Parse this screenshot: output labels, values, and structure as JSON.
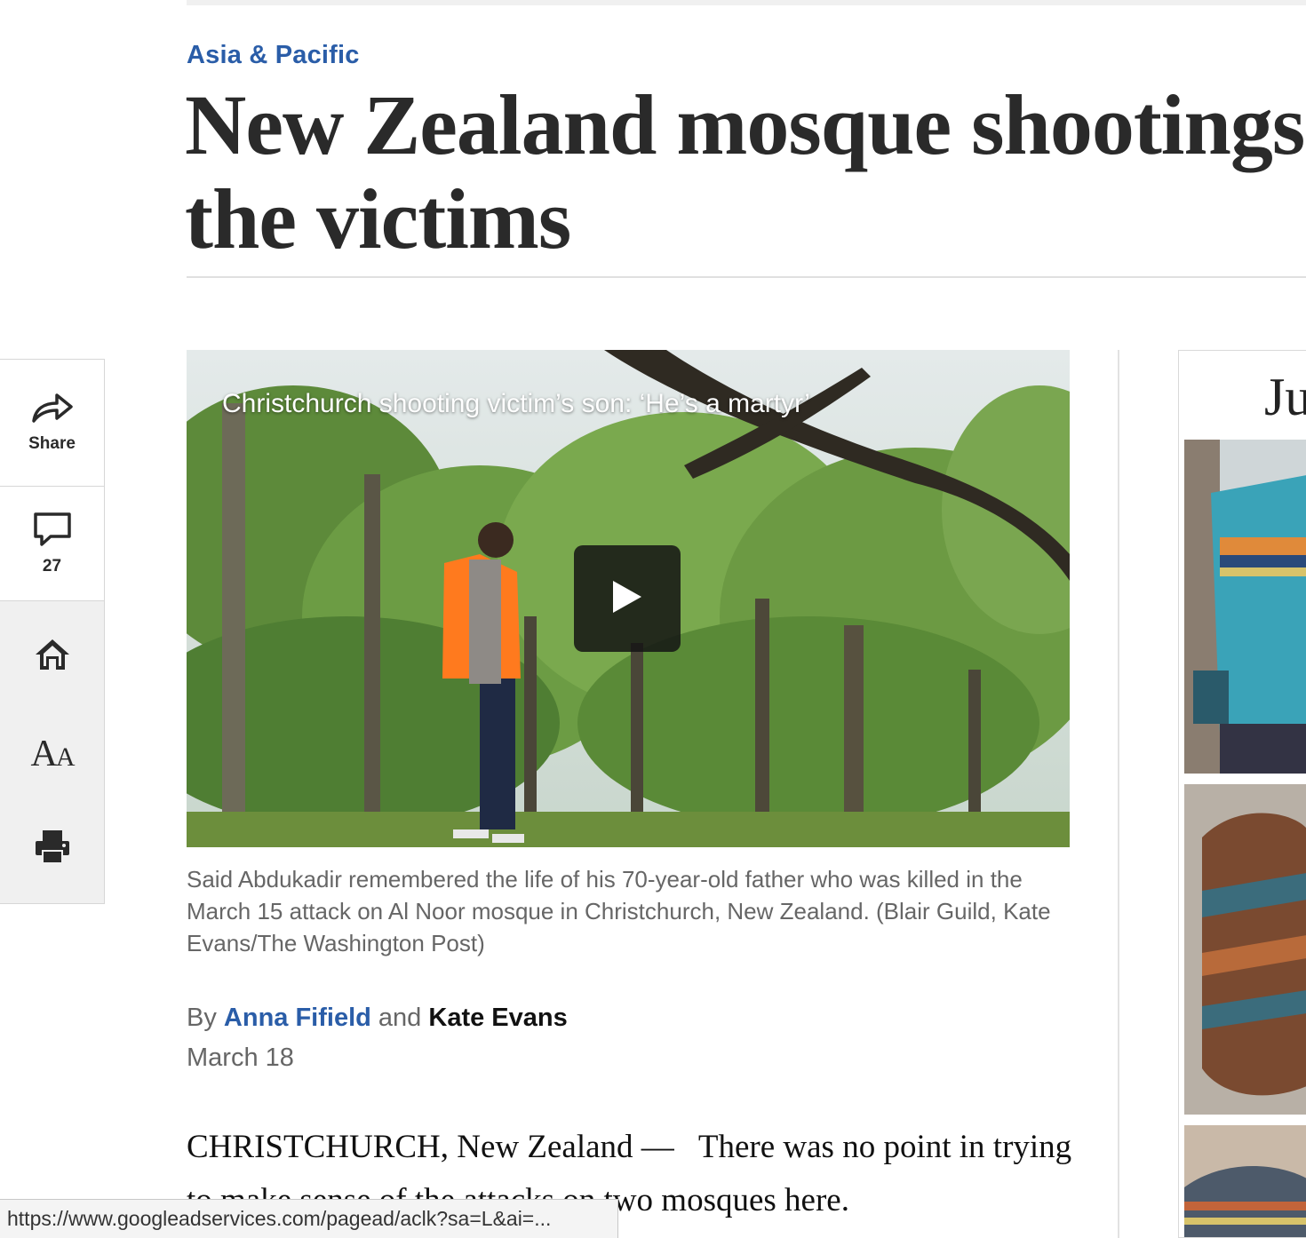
{
  "article": {
    "kicker": "Asia & Pacific",
    "headline_line1": "New Zealand mosque shootings:",
    "headline_line2": "the victims"
  },
  "sharebar": {
    "share_label": "Share",
    "comment_count": "27",
    "icons": [
      "share-arrow-icon",
      "comment-bubble-icon",
      "home-icon",
      "text-size-icon",
      "print-icon"
    ]
  },
  "video": {
    "title": "Christchurch shooting victim’s son: ‘He’s a martyr’",
    "caption": "Said Abdukadir remembered the life of his 70-year-old father who was killed in the March 15 attack on Al Noor mosque in Christchurch, New Zealand. (Blair Guild, Kate Evans/The Washington Post)"
  },
  "byline": {
    "by": "By",
    "author1": "Anna Fifield",
    "and": "and",
    "author2": "Kate Evans",
    "date": "March 18"
  },
  "body": {
    "dateline": "CHRISTCHURCH, New Zealand —",
    "text": "There was no point in trying to make sense of the attacks on two mosques here."
  },
  "ad": {
    "headline_fragment": "Ju"
  },
  "statusbar": {
    "url": "https://www.googleadservices.com/pagead/aclk?sa=L&ai=..."
  },
  "colors": {
    "kicker": "#2a5da8",
    "headline": "#2a2a2a",
    "caption": "#666666",
    "author_link": "#2a5da8"
  }
}
